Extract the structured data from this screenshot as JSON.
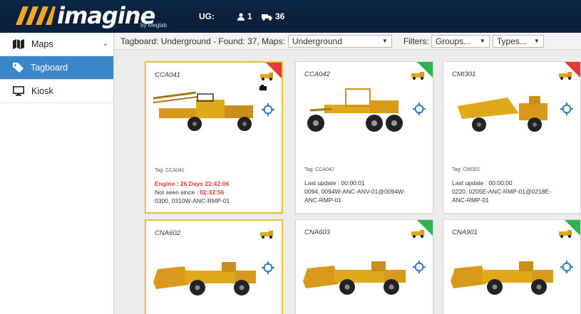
{
  "header": {
    "logo_text": "imagine",
    "logo_sub": "by Meglab",
    "ug_label": "UG:",
    "people_count": "1",
    "vehicle_count": "36",
    "bg_color": "#0b2240"
  },
  "sidebar": {
    "items": [
      {
        "label": "Maps",
        "icon": "map-icon"
      },
      {
        "label": "Tagboard",
        "icon": "tag-icon",
        "active": true
      },
      {
        "label": "Kiosk",
        "icon": "monitor-icon"
      }
    ]
  },
  "toolbar": {
    "summary": "Tagboard: Underground - Found: 37, Maps:",
    "maps_value": "Underground",
    "filters_label": "Filters:",
    "groups_value": "Groups...",
    "types_value": "Types..."
  },
  "cards": [
    {
      "name": "CCA041",
      "status": "red",
      "tag": "Tag: CCA041",
      "line1": "Engine : 26 Days 22:42:06",
      "line2_label": "Not seen since : ",
      "line2_value": "02:32:56",
      "line3": "0300, 0310W-ANC-RMP-01"
    },
    {
      "name": "CCA042",
      "status": "green",
      "tag": "Tag: CCA042",
      "line1": "Last update : 00:00:01",
      "line2": "0094, 0094W-ANC-ANV-01@0094W-",
      "line3": "ANC-RMP-01"
    },
    {
      "name": "CMI301",
      "status": "red",
      "tag": "Tag: CMI301",
      "line1": "Last update : 00:00:00",
      "line2": "0220, 0205E-ANC-RMP-01@0218E-",
      "line3": "ANC-RMP-01"
    },
    {
      "name": "CNA602",
      "status": "green"
    },
    {
      "name": "CNA603",
      "status": "green"
    },
    {
      "name": "CNA901",
      "status": "green"
    }
  ],
  "colors": {
    "accent": "#3a86c8",
    "alert_border": "#e8c23c",
    "red": "#e53935",
    "green": "#2fb34a",
    "machine_yellow": "#e0a81a"
  }
}
